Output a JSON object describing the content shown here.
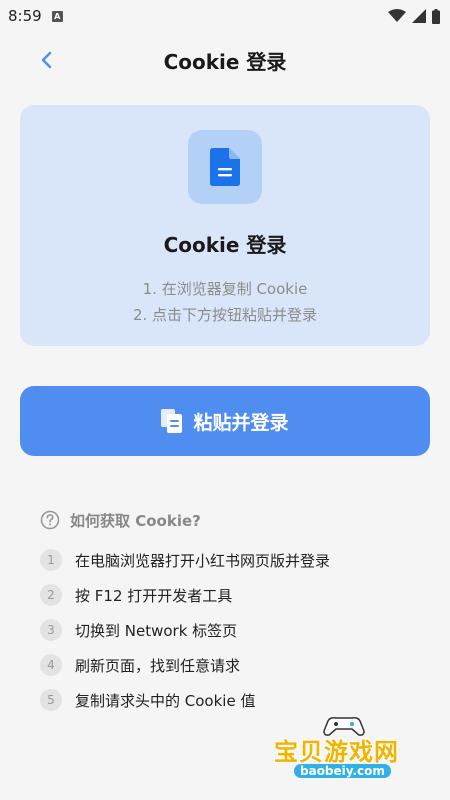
{
  "status_bar": {
    "time": "8:59"
  },
  "header": {
    "title": "Cookie 登录"
  },
  "info_card": {
    "title": "Cookie 登录",
    "steps": [
      "1. 在浏览器复制 Cookie",
      "2. 点击下方按钮粘贴并登录"
    ]
  },
  "paste_button": {
    "label": "粘贴并登录"
  },
  "help": {
    "title": "如何获取 Cookie?",
    "items": [
      {
        "num": "1",
        "text": "在电脑浏览器打开小红书网页版并登录"
      },
      {
        "num": "2",
        "text": "按 F12 打开开发者工具"
      },
      {
        "num": "3",
        "text": "切换到 Network 标签页"
      },
      {
        "num": "4",
        "text": "刷新页面，找到任意请求"
      },
      {
        "num": "5",
        "text": "复制请求头中的 Cookie 值"
      }
    ]
  },
  "watermark": {
    "title": "宝贝游戏网",
    "url": "baobeiy.com"
  },
  "colors": {
    "accent": "#4f8df0",
    "card_bg": "#d9e6fa",
    "icon_blue": "#1a73e8"
  }
}
